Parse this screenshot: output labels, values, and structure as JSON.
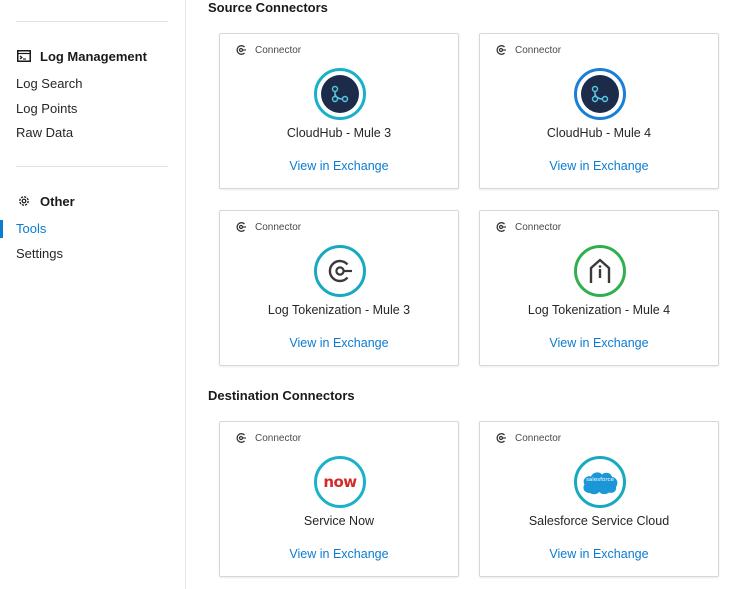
{
  "sidebar": {
    "log_management": {
      "title": "Log Management",
      "items": [
        {
          "label": "Log Search"
        },
        {
          "label": "Log Points"
        },
        {
          "label": "Raw Data"
        }
      ]
    },
    "other": {
      "title": "Other",
      "items": [
        {
          "label": "Tools",
          "active": true
        },
        {
          "label": "Settings"
        }
      ]
    }
  },
  "main": {
    "source_title": "Source Connectors",
    "destination_title": "Destination Connectors",
    "cards": [
      {
        "tag": "Connector",
        "name": "CloudHub - Mule 3",
        "link": "View in Exchange",
        "icon": "cloudhub-icon"
      },
      {
        "tag": "Connector",
        "name": "CloudHub - Mule 4",
        "link": "View in Exchange",
        "icon": "cloudhub-icon"
      },
      {
        "tag": "Connector",
        "name": "Log Tokenization - Mule 3",
        "link": "View in Exchange",
        "icon": "connector-icon"
      },
      {
        "tag": "Connector",
        "name": "Log Tokenization - Mule 4",
        "link": "View in Exchange",
        "icon": "house-arrow-icon"
      },
      {
        "tag": "Connector",
        "name": "Service Now",
        "link": "View in Exchange",
        "icon": "servicenow-logo",
        "logo_text": "now"
      },
      {
        "tag": "Connector",
        "name": "Salesforce Service Cloud",
        "link": "View in Exchange",
        "icon": "salesforce-logo",
        "logo_text": "salesforce"
      }
    ]
  },
  "colors": {
    "accent": "#0a7cd2",
    "teal": "#18b1c8",
    "blue": "#1a7fd6",
    "green": "#2fb04e",
    "servicenow_red": "#d42a2a",
    "salesforce_blue": "#1b96d6",
    "cloudhub_dark": "#1d2b4a"
  }
}
